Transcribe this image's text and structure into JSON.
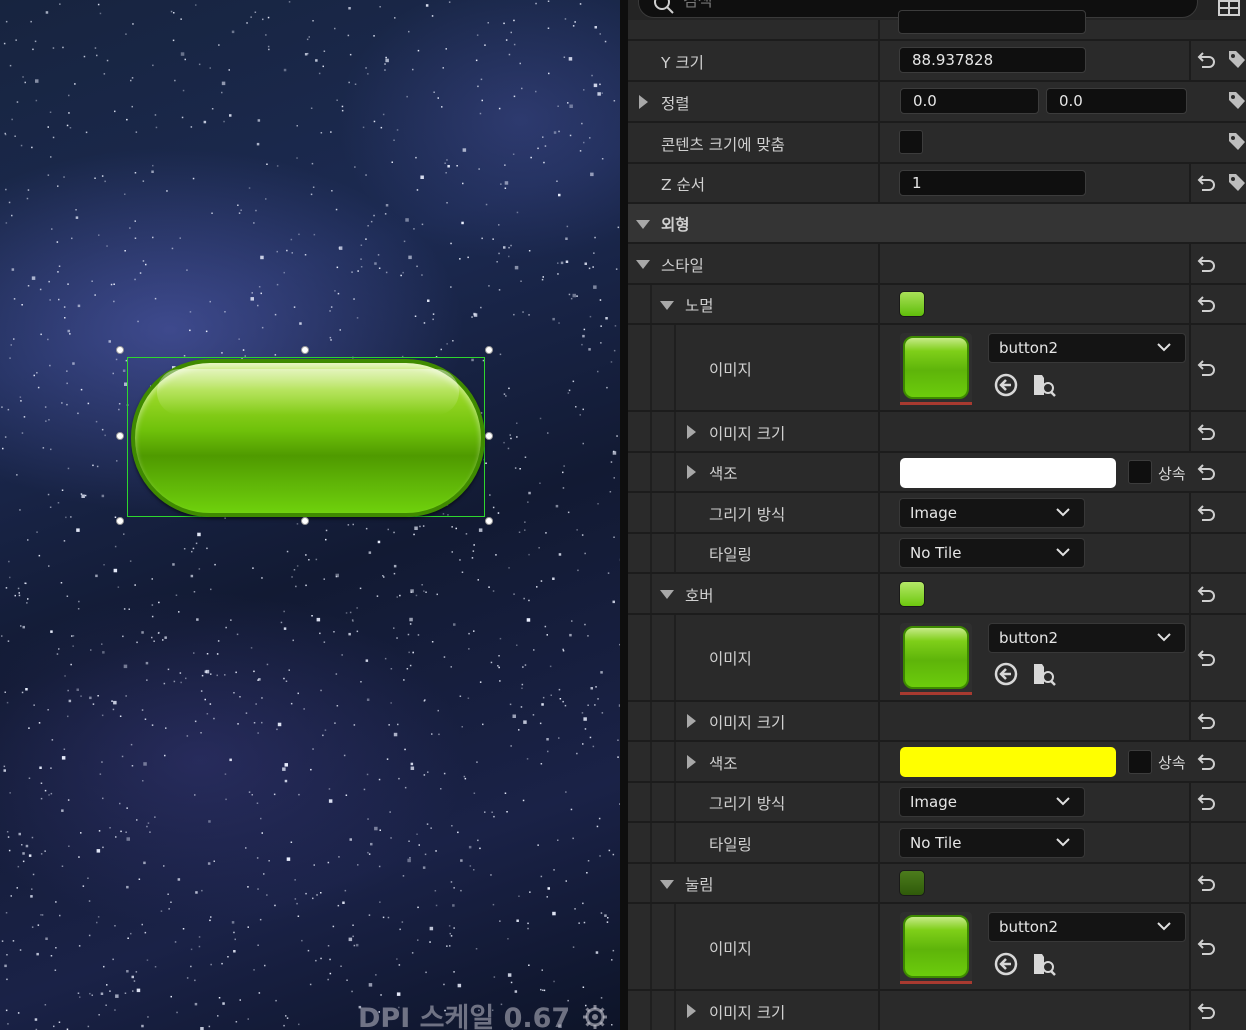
{
  "viewport": {
    "dpi_label": "DPI 스케일 0.67",
    "icons": {
      "gear": "gear-icon"
    }
  },
  "panel": {
    "search": {
      "placeholder": "검색",
      "icon": "search-icon"
    },
    "header_icon": "grid-view-icon",
    "rows": {
      "size_y": {
        "label": "Y 크기",
        "value": "88.937828"
      },
      "alignment": {
        "label": "정렬",
        "x": "0.0",
        "y": "0.0"
      },
      "size_to_content": {
        "label": "콘텐츠 크기에 맞춤",
        "checked": false
      },
      "z_order": {
        "label": "Z 순서",
        "value": "1"
      },
      "appearance": {
        "label": "외형"
      },
      "style": {
        "label": "스타일"
      }
    },
    "states": [
      {
        "label": "노멀",
        "swatch_color": "#5fbe0a",
        "image_label": "이미지",
        "image_value": "button2",
        "image_size_label": "이미지 크기",
        "tint_label": "색조",
        "tint_color": "#ffffff",
        "inherit_label": "상속",
        "draw_as_label": "그리기 방식",
        "draw_as_value": "Image",
        "tiling_label": "타일링",
        "tiling_value": "No Tile"
      },
      {
        "label": "호버",
        "swatch_color": "#6cc80e",
        "image_label": "이미지",
        "image_value": "button2",
        "image_size_label": "이미지 크기",
        "tint_label": "색조",
        "tint_color": "#ffff00",
        "inherit_label": "상속",
        "draw_as_label": "그리기 방식",
        "draw_as_value": "Image",
        "tiling_label": "타일링",
        "tiling_value": "No Tile"
      },
      {
        "label": "눌림",
        "swatch_color": "#2f5a0a",
        "image_label": "이미지",
        "image_value": "button2",
        "image_size_label": "이미지 크기"
      }
    ],
    "icons": {
      "reset": "reset-arrow-icon",
      "keyframe": "keyframe-tag-icon",
      "use_selected": "use-selected-asset-icon",
      "browse": "browse-asset-icon",
      "dropdown": "chevron-down-icon",
      "expand": "triangle-expand-icon",
      "collapse": "triangle-collapse-icon"
    }
  }
}
